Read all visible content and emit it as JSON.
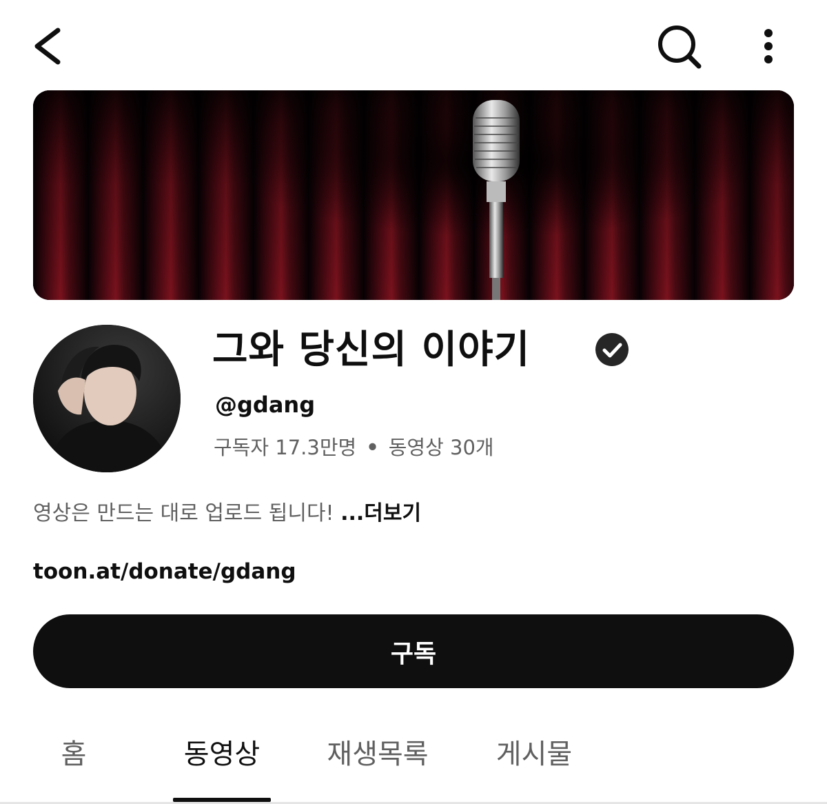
{
  "header": {
    "back_icon": "chevron-left-icon",
    "search_icon": "search-icon",
    "more_icon": "more-vertical-icon"
  },
  "channel": {
    "title": "그와 당신의 이야기",
    "verified_icon": "verified-check-icon",
    "handle": "@gdang",
    "subscribers": "구독자 17.3만명",
    "separator": "•",
    "videos": "동영상 30개",
    "description": "영상은 만드는 대로 업로드 됩니다! ",
    "more_label": "...더보기",
    "link": "toon.at/donate/gdang"
  },
  "subscribe_label": "구독",
  "tabs": [
    {
      "label": "홈",
      "active": false
    },
    {
      "label": "동영상",
      "active": true
    },
    {
      "label": "재생목록",
      "active": false
    },
    {
      "label": "게시물",
      "active": false
    }
  ],
  "colors": {
    "text_primary": "#0f0f0f",
    "text_secondary": "#606060",
    "button_bg": "#0f0f0f",
    "button_text": "#ffffff"
  }
}
